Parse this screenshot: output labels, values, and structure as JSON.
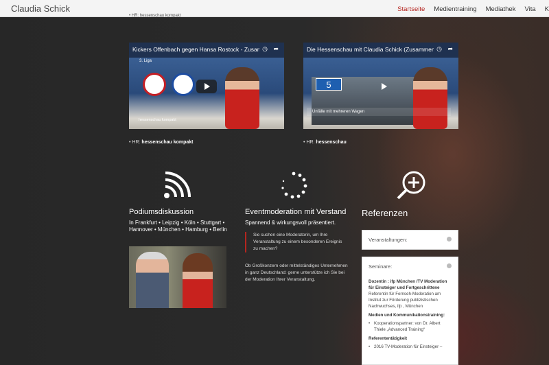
{
  "header": {
    "brand": "Claudia Schick",
    "nav": [
      "Startseite",
      "Medientraining",
      "Mediathek",
      "Vita",
      "K"
    ],
    "active": "Startseite",
    "ticker": "• HR: hessenschau kompakt"
  },
  "videos": [
    {
      "title": "Kickers Offenbach gegen Hansa Rostock - Zusam...",
      "badge": "3. Liga",
      "caption": "hessenschau kompakt",
      "source_prefix": "HR:",
      "source_name": "hessenschau kompakt"
    },
    {
      "title": "Die Hessenschau mit Claudia Schick (Zusammen...",
      "channel": "5",
      "lower_third": "Unfälle mit mehreren Wagen",
      "source_prefix": "HR:",
      "source_name": "hessenschau"
    }
  ],
  "columns": {
    "podium": {
      "icon": "wifi-icon",
      "title": "Podiumsdiskussion",
      "text": "In Frankfurt • Leipzig • Köln • Stuttgart • Hannover • München • Hamburg • Berlin"
    },
    "event": {
      "icon": "loading-spinner-icon",
      "title": "Eventmoderation mit Verstand",
      "subtitle": "Spannend & wirkungsvoll präsentiert.",
      "quote": "Sie suchen eine Moderatorin, um Ihre Veranstaltung zu einem besonderen Ereignis zu machen?",
      "body": "Ob Großkonzern oder mittelständiges Unternehmen in ganz Deutschland: gerne unterstütze ich Sie bei der Moderation Ihrer Veranstaltung."
    },
    "references": {
      "icon": "zoom-in-icon",
      "title": "Referenzen",
      "acc1": "Veranstaltungen:",
      "acc2": "Seminare:",
      "s1_title": "Dozentin : ifp München /TV Moderation für Einsteiger und Fortgeschrittene",
      "s1_text": "Referentin für Fernseh-Moderation am Institut zur Förderung publizistischen Nachwuchses, ifp , München",
      "s2_title": "Medien und Kommunikationstraining:",
      "s2_item": "Kooperationspartner: von Dr. Albert Thiele „Advanced Training“",
      "s3_title": "Referententätigkeit",
      "s3_item": "2016 TV-Moderation für Einsteiger –"
    }
  },
  "colors": {
    "accent": "#b5251f",
    "header_bg": "#f4f4f4",
    "page_bg": "#2b2b2b"
  }
}
